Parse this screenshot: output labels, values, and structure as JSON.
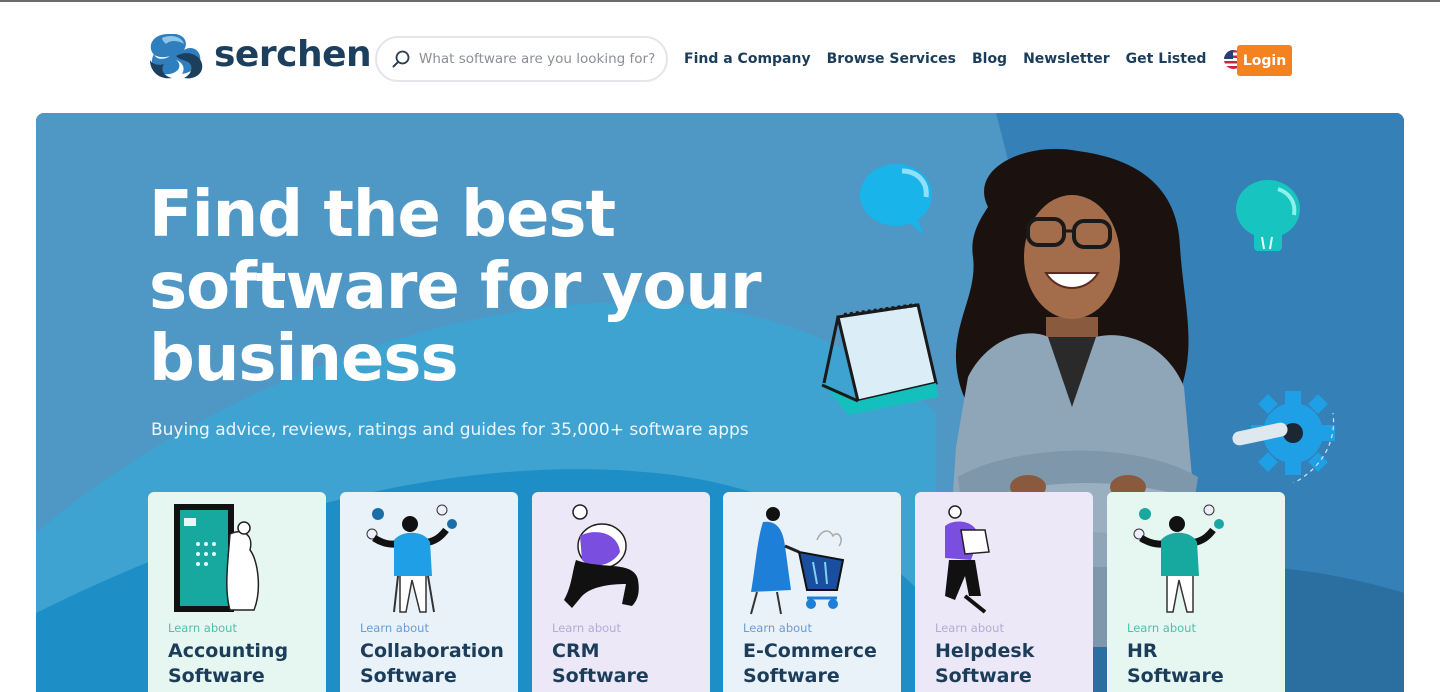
{
  "brand": {
    "name": "serchen",
    "logo_icon": "serchen-swirl-logo",
    "colors": {
      "navy": "#1d3f5e",
      "blue": "#4a94c4",
      "orange": "#f58220"
    }
  },
  "search": {
    "placeholder": "What software are you looking for?",
    "value": "",
    "icon": "search-icon"
  },
  "nav": {
    "items": [
      {
        "label": "Find a Company"
      },
      {
        "label": "Browse Services"
      },
      {
        "label": "Blog"
      },
      {
        "label": "Newsletter"
      },
      {
        "label": "Get Listed"
      }
    ],
    "locale": {
      "label": "US",
      "icon": "us-flag-icon"
    },
    "login_label": "Login"
  },
  "hero": {
    "headline": [
      "Find the best",
      "software for your",
      "business"
    ],
    "subheadline": "Buying advice, reviews, ratings and guides for 35,000+ software apps"
  },
  "categories": [
    {
      "learn": "Learn about",
      "line1": "Accounting",
      "line2": "Software",
      "bg": "#e6f6f0",
      "learn_color": "#4ebfae",
      "illustration": "building-and-figure-illustration"
    },
    {
      "learn": "Learn about",
      "line1": "Collaboration",
      "line2": "Software",
      "bg": "#eaf2f9",
      "learn_color": "#6a9ccf",
      "illustration": "juggling-person-illustration"
    },
    {
      "learn": "Learn about",
      "line1": "CRM",
      "line2": "Software",
      "bg": "#ece8f7",
      "learn_color": "#b4acd6",
      "illustration": "sitting-person-illustration"
    },
    {
      "learn": "Learn about",
      "line1": "E-Commerce",
      "line2": "Software",
      "bg": "#eaf2f9",
      "learn_color": "#6a9ccf",
      "illustration": "shopping-cart-illustration"
    },
    {
      "learn": "Learn about",
      "line1": "Helpdesk",
      "line2": "Software",
      "bg": "#ece8f7",
      "learn_color": "#b4acd6",
      "illustration": "person-with-box-illustration"
    },
    {
      "learn": "Learn about",
      "line1": "HR",
      "line2": "Software",
      "bg": "#e6f6f0",
      "learn_color": "#4ebfae",
      "illustration": "juggling-person-illustration"
    }
  ]
}
